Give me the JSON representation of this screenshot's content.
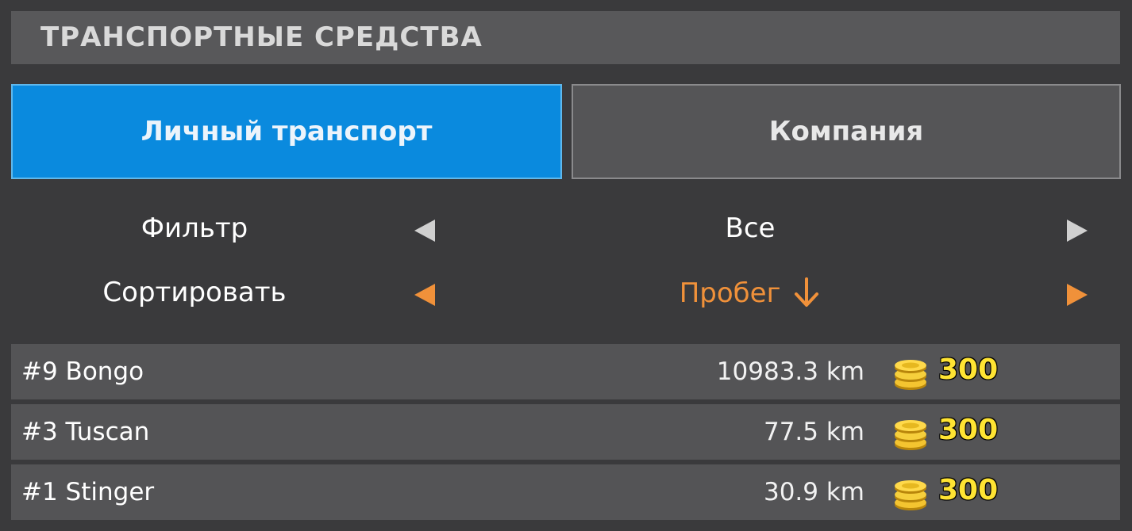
{
  "header": {
    "title": "ТРАНСПОРТНЫЕ СРЕДСТВА"
  },
  "tabs": [
    {
      "label": "Личный транспорт",
      "active": true
    },
    {
      "label": "Компания",
      "active": false
    }
  ],
  "filter": {
    "label": "Фильтр",
    "value": "Все"
  },
  "sort": {
    "label": "Сортировать",
    "value": "Пробег",
    "direction": "descending"
  },
  "vehicles": [
    {
      "name": "#9 Bongo",
      "mileage": "10983.3 km",
      "price": "300"
    },
    {
      "name": "#3 Tuscan",
      "mileage": "77.5 km",
      "price": "300"
    },
    {
      "name": "#1 Stinger",
      "mileage": "30.9 km",
      "price": "300"
    }
  ],
  "colors": {
    "accent_blue": "#0a8ade",
    "sort_orange": "#f0913a",
    "price_yellow": "#ffe433",
    "arrow_grey": "#d0d0d0"
  },
  "icons": {
    "coin": "coin-stack-icon",
    "sort_direction": "arrow-down-icon"
  }
}
